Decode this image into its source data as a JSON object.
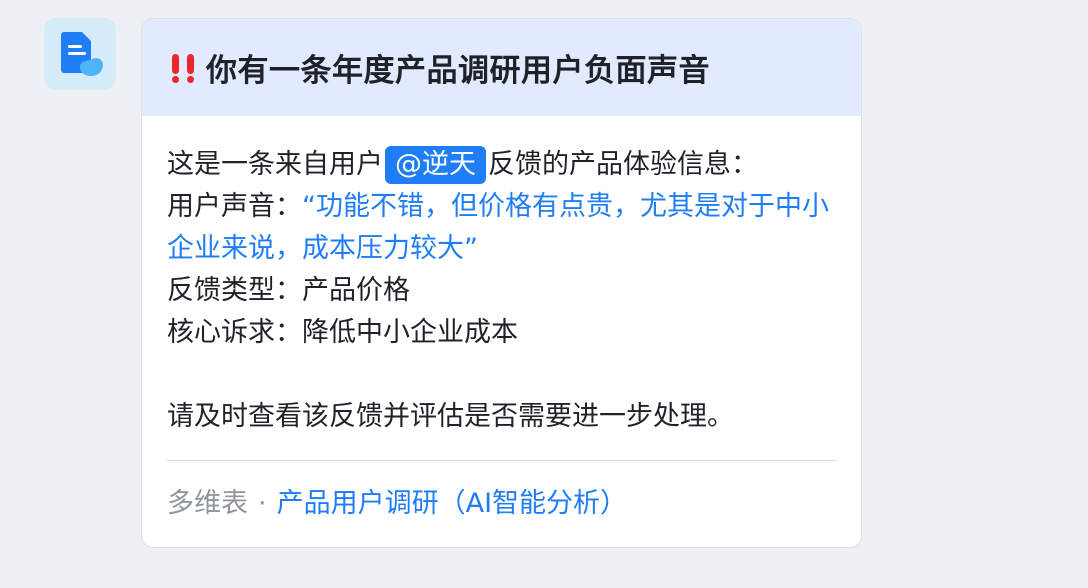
{
  "colors": {
    "page_bg": "#eef0f5",
    "header_bg": "#e1eaff",
    "accent": "#1f7ef5",
    "alert": "#e8262b",
    "muted": "#8f959e",
    "text": "#1f2329"
  },
  "avatar": {
    "icon": "cloud-document-icon"
  },
  "card": {
    "alert_icon": "double-exclamation-icon",
    "title": "你有一条年度产品调研用户负面声音",
    "body": {
      "intro_prefix": "这是一条来自用户",
      "mention": "@逆天",
      "intro_suffix": "反馈的产品体验信息：",
      "voice_label": "用户声音：",
      "voice_quote": "“功能不错，但价格有点贵，尤其是对于中小企业来说，成本压力较大”",
      "type_label": "反馈类型：",
      "type_value": "产品价格",
      "demand_label": "核心诉求：",
      "demand_value": "降低中小企业成本",
      "closing": "请及时查看该反馈并评估是否需要进一步处理。"
    },
    "footer": {
      "source": "多维表",
      "separator": "·",
      "link": "产品用户调研（AI智能分析）"
    }
  }
}
